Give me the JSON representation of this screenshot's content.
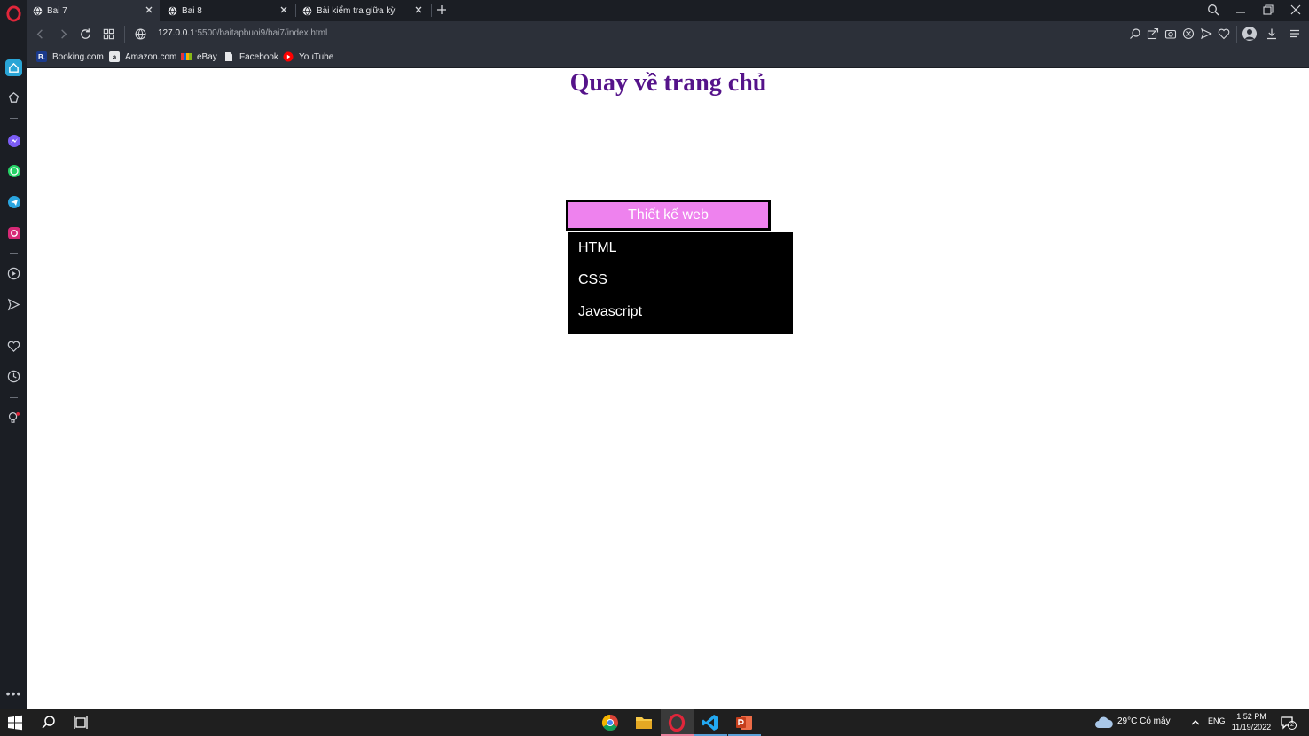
{
  "browser": {
    "tabs": [
      {
        "label": "Bai 7"
      },
      {
        "label": "Bai 8"
      },
      {
        "label": "Bài kiểm tra giữa kỳ"
      }
    ],
    "address": {
      "host": "127.0.0.1",
      "path": ":5500/baitapbuoi9/bai7/index.html"
    },
    "bookmarks": [
      {
        "label": "Booking.com",
        "icon": "booking-icon"
      },
      {
        "label": "Amazon.com",
        "icon": "amazon-icon"
      },
      {
        "label": "eBay",
        "icon": "ebay-icon"
      },
      {
        "label": "Facebook",
        "icon": "page-icon"
      },
      {
        "label": "YouTube",
        "icon": "youtube-icon"
      }
    ],
    "bookmark_letters": {
      "booking": "B.",
      "amazon": "a"
    }
  },
  "page": {
    "title": "Quay về trang chủ",
    "menu_button": "Thiết kế web",
    "dropdown": [
      "HTML",
      "CSS",
      "Javascript"
    ],
    "colors": {
      "title": "#55138a",
      "button_bg": "#ee82ee",
      "dropdown_bg": "#000000"
    }
  },
  "taskbar": {
    "weather": "29°C  Có mây",
    "lang": "ENG",
    "time": "1:52 PM",
    "date": "11/19/2022",
    "notifications": "2"
  }
}
